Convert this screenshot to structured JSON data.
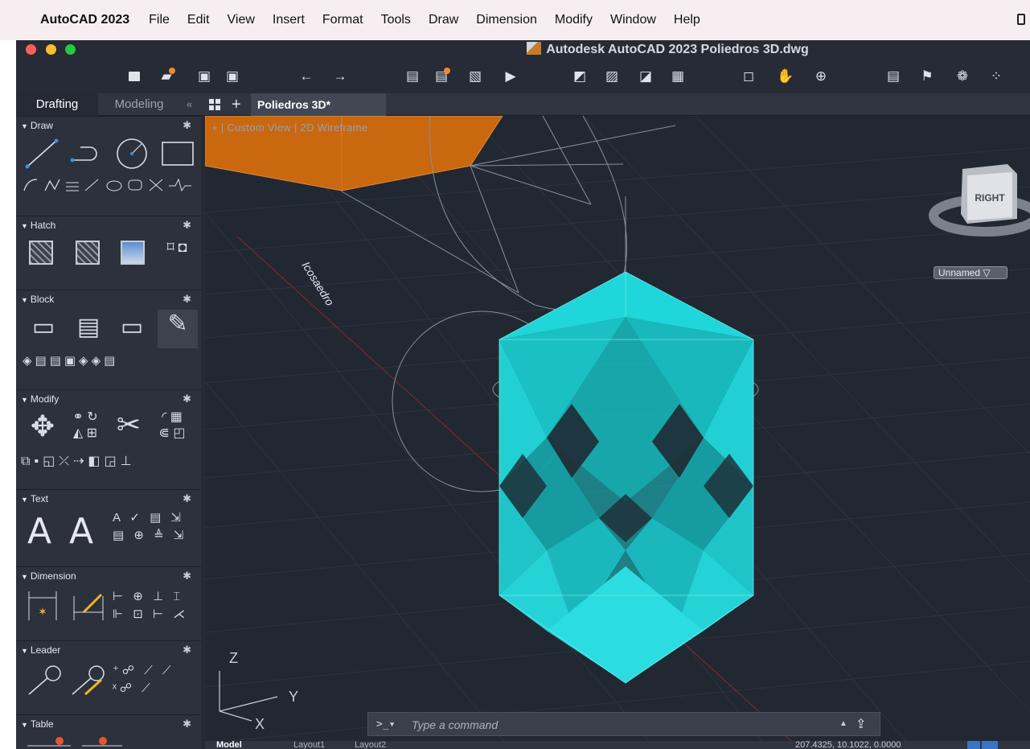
{
  "menubar": {
    "app_name": "AutoCAD 2023",
    "items": [
      "File",
      "Edit",
      "View",
      "Insert",
      "Format",
      "Tools",
      "Draw",
      "Dimension",
      "Modify",
      "Window",
      "Help"
    ]
  },
  "window": {
    "title": "Autodesk AutoCAD 2023   Poliedros 3D.dwg"
  },
  "toolbar": {
    "icons": [
      "new-file-icon",
      "open-file-icon",
      "save-icon",
      "save-as-icon",
      "undo-icon",
      "redo-icon",
      "plot-icon",
      "batch-plot-icon",
      "publish-icon",
      "export-pdf-icon",
      "share-icon",
      "import-icon",
      "attach-icon",
      "layout-icon",
      "zoom-window-icon",
      "pan-icon",
      "orbit-icon",
      "properties-icon",
      "match-icon",
      "render-icon",
      "point-icon"
    ]
  },
  "palette": {
    "tabs": [
      "Drafting",
      "Modeling"
    ],
    "collapse_label": "«",
    "sections": [
      {
        "title": "Draw"
      },
      {
        "title": "Hatch"
      },
      {
        "title": "Block"
      },
      {
        "title": "Modify"
      },
      {
        "title": "Text"
      },
      {
        "title": "Dimension"
      },
      {
        "title": "Leader"
      },
      {
        "title": "Table"
      }
    ]
  },
  "document_tab": {
    "label": "Poliedros 3D*"
  },
  "viewport": {
    "view_label": "+  | Custom View | 2D Wireframe",
    "drawing_text": "Icosaedro",
    "viewcube_face": "RIGHT",
    "viewcube_menu": "Unnamed ▽",
    "ucs_axes": [
      "Z",
      "Y",
      "X"
    ],
    "solid_color": "#1ec8cc",
    "orange_solid_color": "#c9680f"
  },
  "command_line": {
    "prompt": ">_▾",
    "placeholder": "Type a command"
  },
  "status_bar": {
    "tabs": [
      "Model",
      "Layout1",
      "Layout2"
    ],
    "coordinates": "207.4325, 10.1022, 0.0000"
  }
}
